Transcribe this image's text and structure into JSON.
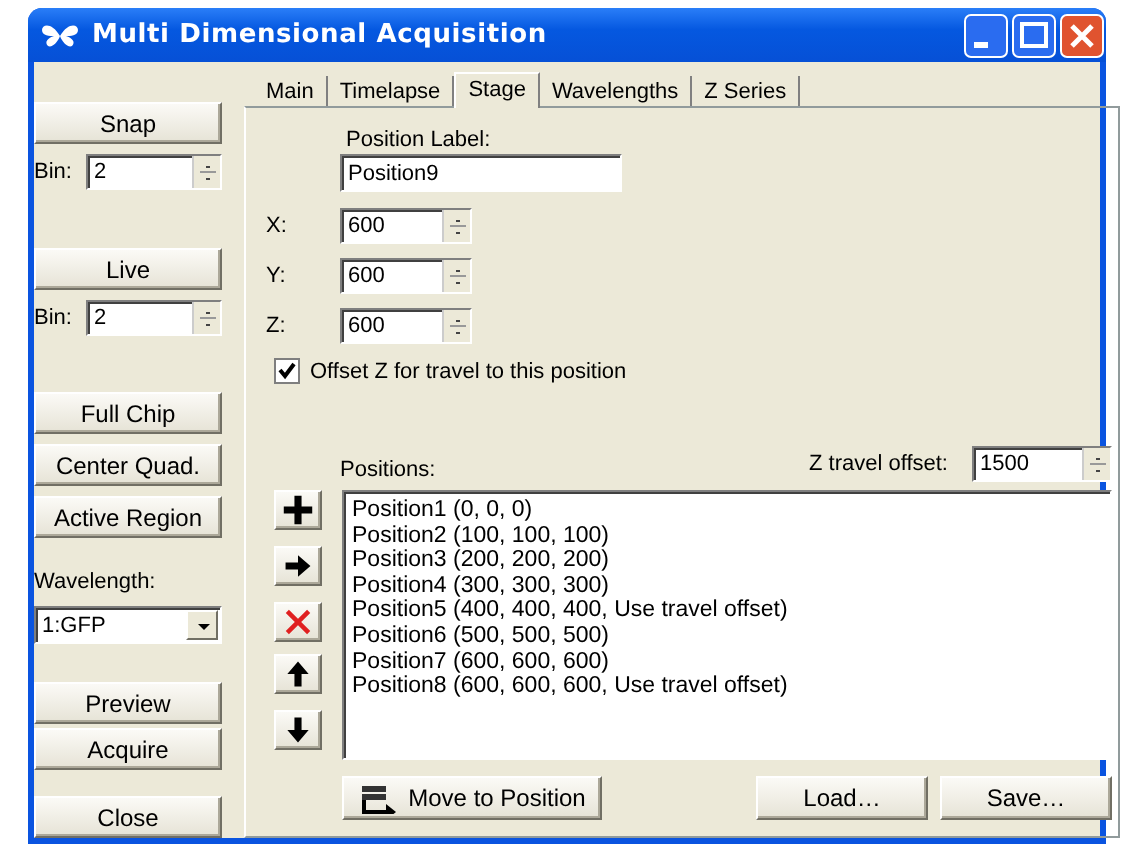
{
  "window": {
    "title": "Multi Dimensional Acquisition"
  },
  "sidebar": [
    {
      "kind": "button",
      "label": "Snap"
    },
    {
      "kind": "spin",
      "label": "Bin:",
      "value": "2"
    },
    {
      "kind": "button",
      "label": "Live"
    },
    {
      "kind": "spin",
      "label": "Bin:",
      "value": "2"
    },
    {
      "kind": "button",
      "label": "Full Chip"
    },
    {
      "kind": "button",
      "label": "Center Quad."
    },
    {
      "kind": "button",
      "label": "Active Region"
    },
    {
      "kind": "label",
      "label": "Wavelength:"
    },
    {
      "kind": "dropdown",
      "value": "1:GFP"
    },
    {
      "kind": "button",
      "label": "Preview"
    },
    {
      "kind": "button",
      "label": "Acquire"
    },
    {
      "kind": "button",
      "label": "Close"
    }
  ],
  "tabs": [
    {
      "label": "Main",
      "selected": false
    },
    {
      "label": "Timelapse",
      "selected": false
    },
    {
      "label": "Stage",
      "selected": true
    },
    {
      "label": "Wavelengths",
      "selected": false
    },
    {
      "label": "Z Series",
      "selected": false
    }
  ],
  "stage": {
    "position_label": {
      "label": "Position Label:",
      "value": "Position9"
    },
    "coordinates": [
      {
        "label": "X:",
        "value": "600"
      },
      {
        "label": "Y:",
        "value": "600"
      },
      {
        "label": "Z:",
        "value": "600"
      }
    ],
    "offset_checkbox": {
      "label": "Offset Z for travel to this position",
      "checked": true
    },
    "positions_label": "Positions:",
    "z_travel_offset": {
      "label": "Z travel offset:",
      "value": "1500"
    },
    "positions": [
      "Position1 (0, 0, 0)",
      "Position2 (100, 100, 100)",
      "Position3 (200, 200, 200)",
      "Position4 (300, 300, 300)",
      "Position5 (400, 400, 400, Use travel offset)",
      "Position6 (500, 500, 500)",
      "Position7 (600, 600, 600)",
      "Position8 (600, 600, 600, Use travel offset)"
    ],
    "buttons": [
      {
        "kind": "move",
        "label": "Move to Position"
      },
      {
        "kind": "plain",
        "label": "Load…"
      },
      {
        "kind": "plain",
        "label": "Save…"
      }
    ]
  }
}
